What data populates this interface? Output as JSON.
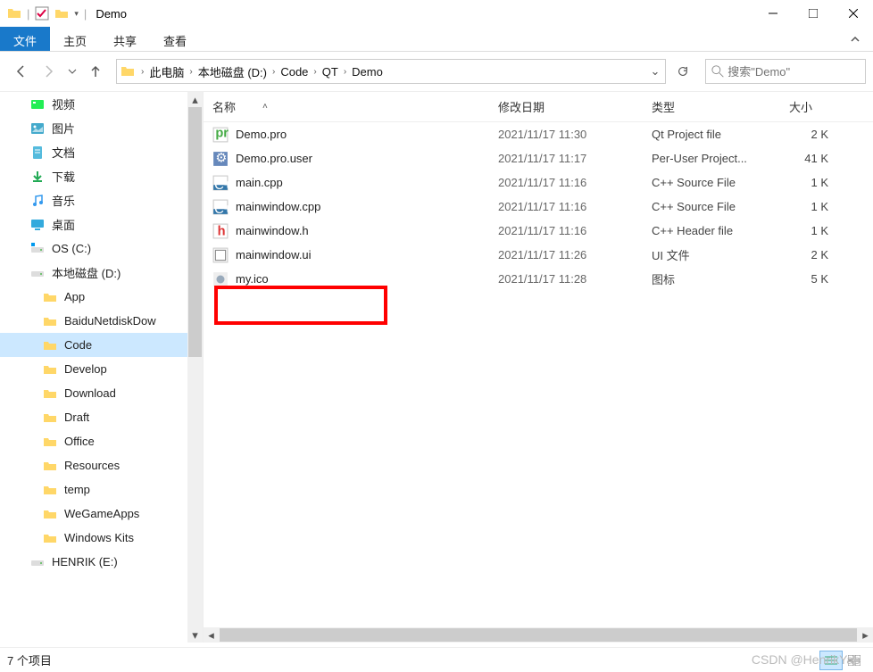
{
  "window": {
    "title": "Demo",
    "separator": "|"
  },
  "ribbon": {
    "file": "文件",
    "tabs": [
      "主页",
      "共享",
      "查看"
    ]
  },
  "breadcrumb": {
    "items": [
      "此电脑",
      "本地磁盘 (D:)",
      "Code",
      "QT",
      "Demo"
    ]
  },
  "search": {
    "placeholder": "搜索\"Demo\""
  },
  "sidebar": {
    "items": [
      {
        "label": "视频",
        "icon": "video",
        "indent": 0
      },
      {
        "label": "图片",
        "icon": "pictures",
        "indent": 0
      },
      {
        "label": "文档",
        "icon": "documents",
        "indent": 0
      },
      {
        "label": "下载",
        "icon": "downloads",
        "indent": 0
      },
      {
        "label": "音乐",
        "icon": "music",
        "indent": 0
      },
      {
        "label": "桌面",
        "icon": "desktop",
        "indent": 0
      },
      {
        "label": "OS (C:)",
        "icon": "osdrive",
        "indent": 0
      },
      {
        "label": "本地磁盘 (D:)",
        "icon": "drive",
        "indent": 0
      },
      {
        "label": "App",
        "icon": "folder",
        "indent": 1
      },
      {
        "label": "BaiduNetdiskDow",
        "icon": "folder",
        "indent": 1
      },
      {
        "label": "Code",
        "icon": "folder",
        "indent": 1,
        "selected": true
      },
      {
        "label": "Develop",
        "icon": "folder",
        "indent": 1
      },
      {
        "label": "Download",
        "icon": "folder",
        "indent": 1
      },
      {
        "label": "Draft",
        "icon": "folder",
        "indent": 1
      },
      {
        "label": "Office",
        "icon": "folder",
        "indent": 1
      },
      {
        "label": "Resources",
        "icon": "folder",
        "indent": 1
      },
      {
        "label": "temp",
        "icon": "folder",
        "indent": 1
      },
      {
        "label": "WeGameApps",
        "icon": "folder",
        "indent": 1
      },
      {
        "label": "Windows Kits",
        "icon": "folder",
        "indent": 1
      },
      {
        "label": "HENRIK (E:)",
        "icon": "drive",
        "indent": 0
      }
    ]
  },
  "columns": {
    "name": "名称",
    "date": "修改日期",
    "type": "类型",
    "size": "大小"
  },
  "files": [
    {
      "name": "Demo.pro",
      "date": "2021/11/17 11:30",
      "type": "Qt Project file",
      "size": "2 K",
      "icon": "pro"
    },
    {
      "name": "Demo.pro.user",
      "date": "2021/11/17 11:17",
      "type": "Per-User Project...",
      "size": "41 K",
      "icon": "vs"
    },
    {
      "name": "main.cpp",
      "date": "2021/11/17 11:16",
      "type": "C++ Source File",
      "size": "1 K",
      "icon": "cpp"
    },
    {
      "name": "mainwindow.cpp",
      "date": "2021/11/17 11:16",
      "type": "C++ Source File",
      "size": "1 K",
      "icon": "cpp"
    },
    {
      "name": "mainwindow.h",
      "date": "2021/11/17 11:16",
      "type": "C++ Header file",
      "size": "1 K",
      "icon": "h"
    },
    {
      "name": "mainwindow.ui",
      "date": "2021/11/17 11:26",
      "type": "UI 文件",
      "size": "2 K",
      "icon": "ui"
    },
    {
      "name": "my.ico",
      "date": "2021/11/17 11:28",
      "type": "图标",
      "size": "5 K",
      "icon": "ico"
    }
  ],
  "status": {
    "text": "7 个项目"
  },
  "watermark": "CSDN @HenrikYao"
}
